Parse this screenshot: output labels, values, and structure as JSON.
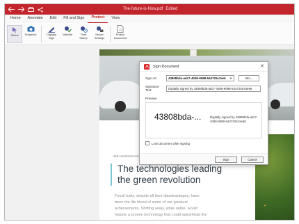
{
  "window": {
    "title": "The-future-is-Now.pdf",
    "title_suffix": "Edited"
  },
  "menubar": {
    "items": [
      {
        "label": "Home",
        "active": false
      },
      {
        "label": "Annotate",
        "active": false
      },
      {
        "label": "Edit",
        "active": false
      },
      {
        "label": "Fill and Sign",
        "active": false
      },
      {
        "label": "Protect",
        "active": true
      },
      {
        "label": "View",
        "active": false
      }
    ]
  },
  "ribbon": {
    "buttons": [
      {
        "label": "Select",
        "icon": "cursor-icon"
      },
      {
        "label": "Snapshot",
        "icon": "camera-icon"
      },
      {
        "label": "Digitally\nSign",
        "icon": "sign-pen-icon"
      },
      {
        "label": "Validate",
        "icon": "validate-icon"
      },
      {
        "label": "Time\nStamp",
        "icon": "timestamp-icon"
      },
      {
        "label": "Server\nSettings",
        "icon": "server-settings-icon"
      },
      {
        "label": "Protect\nDocument",
        "icon": "protect-document-icon"
      }
    ]
  },
  "document": {
    "small_label": "dell.com/electronic/",
    "heading_line1": "The technologies leading",
    "heading_line2": "the green revolution",
    "body_lines": [
      "Fossil fuels, despite all their disadvantages, have",
      "been the life blood of some of our greatest",
      "achievements. Shifting away, while noble, would",
      "require a proven technology that could spearhead the"
    ]
  },
  "dialog": {
    "title": "Sign Document",
    "sign_as_label": "Sign As:",
    "sign_as_value": "43808bda-adc7-40d6-9088-644720a7ae6",
    "info_button": "Info...",
    "signature_text_label": "Signature Text:",
    "signature_text_value": "Digitally signed by 43808bda-adc7-40d6-9088-644720a7ae66",
    "preview_label": "Preview",
    "preview_big": "43808bda-...",
    "preview_small": "Digitally signed by 43808bda-adc7-40d6-9088-644720a7ae66",
    "lock_label": "Lock document after signing",
    "lock_checked": false,
    "sign_button": "Sign",
    "cancel_button": "Cancel"
  },
  "colors": {
    "brand": "#c2252c",
    "accent_line": "#7fc5d4"
  }
}
